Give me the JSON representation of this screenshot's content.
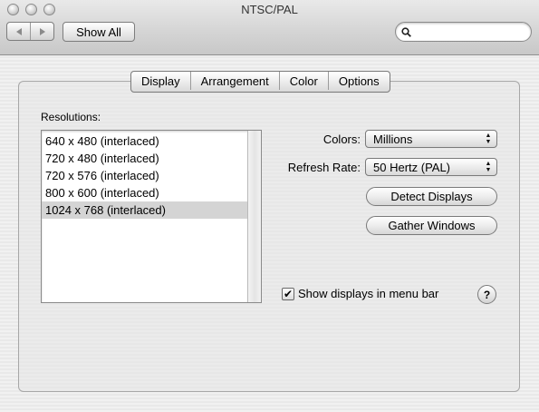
{
  "window": {
    "title": "NTSC/PAL"
  },
  "toolbar": {
    "back_icon": "back-arrow-icon",
    "forward_icon": "forward-arrow-icon",
    "show_all_label": "Show All",
    "search_value": "",
    "search_placeholder": ""
  },
  "tabs": [
    {
      "label": "Display",
      "active": true
    },
    {
      "label": "Arrangement",
      "active": false
    },
    {
      "label": "Color",
      "active": false
    },
    {
      "label": "Options",
      "active": false
    }
  ],
  "resolutions": {
    "label": "Resolutions:",
    "items": [
      "640 x 480 (interlaced)",
      "720 x 480 (interlaced)",
      "720 x 576 (interlaced)",
      "800 x 600 (interlaced)",
      "1024 x 768 (interlaced)"
    ],
    "selected_index": 4
  },
  "colors": {
    "label": "Colors:",
    "value": "Millions"
  },
  "refresh_rate": {
    "label": "Refresh Rate:",
    "value": "50 Hertz (PAL)"
  },
  "buttons": {
    "detect_displays": "Detect Displays",
    "gather_windows": "Gather Windows"
  },
  "menu_bar_option": {
    "label": "Show displays in menu bar",
    "checked": true,
    "check_mark": "✔"
  },
  "help": {
    "label": "?"
  }
}
